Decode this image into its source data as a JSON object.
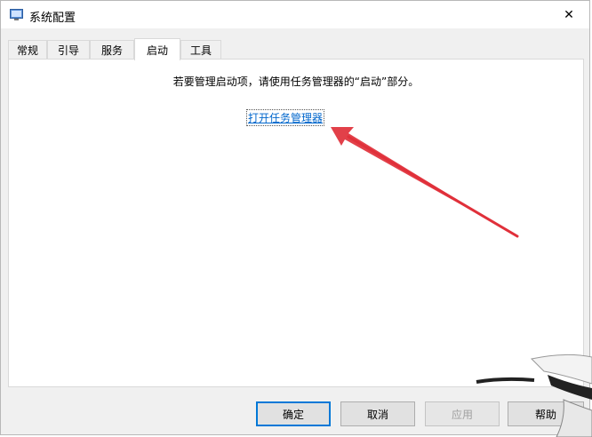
{
  "window": {
    "title": "系统配置",
    "close_glyph": "✕"
  },
  "tabs": [
    {
      "label": "常规",
      "active": false
    },
    {
      "label": "引导",
      "active": false
    },
    {
      "label": "服务",
      "active": false
    },
    {
      "label": "启动",
      "active": true
    },
    {
      "label": "工具",
      "active": false
    }
  ],
  "panel": {
    "info_text": "若要管理启动项，请使用任务管理器的“启动”部分。",
    "link_text": "打开任务管理器"
  },
  "buttons": {
    "ok": "确定",
    "cancel": "取消",
    "apply": "应用",
    "help": "帮助"
  },
  "annotation": {
    "arrow_color": "#e0303a"
  }
}
